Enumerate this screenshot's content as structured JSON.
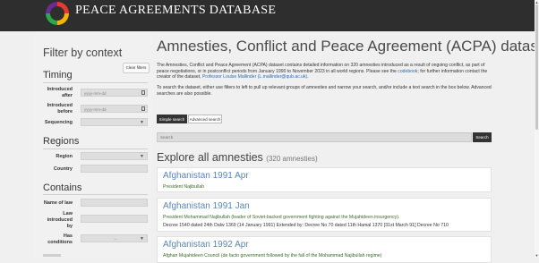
{
  "site": {
    "title": "PEACE AGREEMENTS DATABASE",
    "logo_colors": [
      "#e63a2e",
      "#f5b400",
      "#2aa84a",
      "#6a2c91"
    ]
  },
  "sidebar": {
    "title": "Filter by context",
    "clear_label": "Clear filters",
    "timing": {
      "heading": "Timing",
      "introduced_after_label": "Introduced after",
      "introduced_after_placeholder": "yyyy-mm-dd",
      "introduced_before_label": "Introduced before",
      "introduced_before_placeholder": "yyyy-mm-dd",
      "sequencing_label": "Sequencing"
    },
    "regions": {
      "heading": "Regions",
      "region_label": "Region",
      "country_label": "Country"
    },
    "contains": {
      "heading": "Contains",
      "name_of_law_label": "Name of law",
      "law_introduced_by_label": "Law introduced by",
      "has_conditions_label": "Has conditions",
      "has_conditions_value": "--"
    }
  },
  "main": {
    "title": "Amnesties, Conflict and Peace Agreement (ACPA) dataset",
    "intro1_a": "The Amnesties, Conflict and Peace Agreement (ACPA) dataset contains detailed information on 320 amnesties introduced as a result of ongoing conflict, as part of peace negotiations, or in postconflict periods from January 1990 to November 2023 in all world regions. Please see the ",
    "intro1_link": "codebook",
    "intro1_b": "; for further information contact the creator of the dataset, ",
    "intro1_contact": "Professor Louise Mallinder (L.mallinder@qub.ac.uk)",
    "intro1_end": ".",
    "intro2": "To search the dataset, either use filters to left to pull up relevant groups of amnesties and narrow your search, and/or include a text search in the box below. Advanced searches are also possible.",
    "tabs": {
      "simple": "Simple search",
      "advanced": "Advanced search"
    },
    "search_placeholder": "Search",
    "search_button": "Search",
    "explore_title": "Explore all amnesties",
    "explore_count": "(320 amnesties)",
    "cards": [
      {
        "title": "Afghanistan 1991 Apr",
        "line1": "President Najibullah",
        "line2": ""
      },
      {
        "title": "Afghanistan 1991 Jan",
        "line1": "President Mohammad Najibullah (leader of Soviet-backed government fighting against the Mujahideen insurgency).",
        "line2": "Decree 1540 dated 24th Dalw 1369 (14 January 1991) Extended by: Decree No 70 dated 11th Hamal 1370 [31st March 91] Decree No 710"
      },
      {
        "title": "Afghanistan 1992 Apr",
        "line1": "Afghan Mujahideen Council (de facto government followed by the fall of the Mohammad Najibullah regime)",
        "line2": ""
      }
    ]
  }
}
